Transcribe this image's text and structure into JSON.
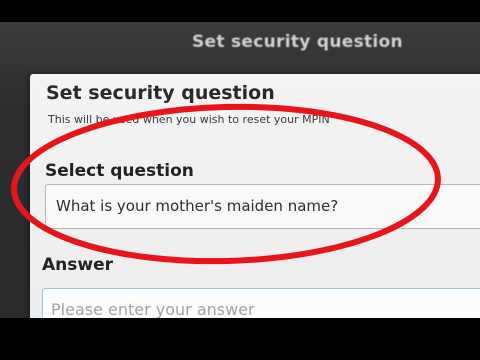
{
  "header": {
    "title": "Set security question"
  },
  "sheet": {
    "title": "Set security question",
    "subtitle": "This will be used when you wish to reset your MPIN"
  },
  "select_question": {
    "label": "Select question",
    "value": "What is your mother's maiden name?"
  },
  "answer": {
    "label": "Answer",
    "placeholder": "Please enter your answer"
  },
  "colors": {
    "highlight": "#e8141a"
  }
}
